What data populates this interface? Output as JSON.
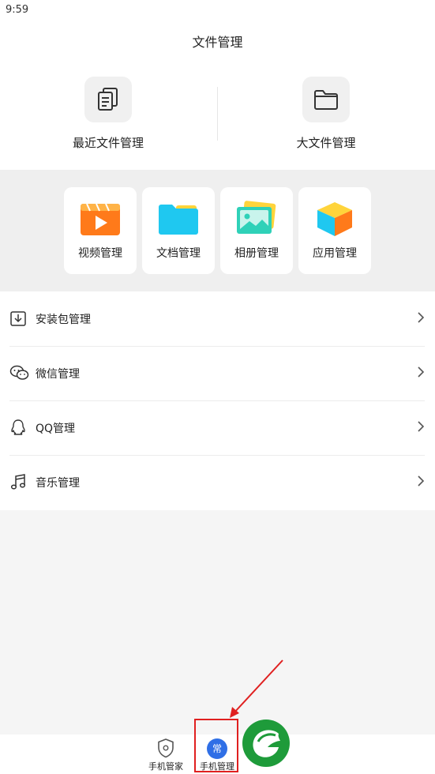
{
  "status_bar": {
    "time": "9:59"
  },
  "header": {
    "title": "文件管理"
  },
  "top_cards": [
    {
      "label": "最近文件管理",
      "icon": "recent-files-icon"
    },
    {
      "label": "大文件管理",
      "icon": "folder-icon"
    }
  ],
  "grid": [
    {
      "label": "视频管理",
      "icon": "video-icon"
    },
    {
      "label": "文档管理",
      "icon": "document-folder-icon"
    },
    {
      "label": "相册管理",
      "icon": "album-icon"
    },
    {
      "label": "应用管理",
      "icon": "app-cube-icon"
    }
  ],
  "list": [
    {
      "label": "安装包管理",
      "icon": "download-box-icon"
    },
    {
      "label": "微信管理",
      "icon": "wechat-icon"
    },
    {
      "label": "QQ管理",
      "icon": "qq-icon"
    },
    {
      "label": "音乐管理",
      "icon": "music-note-icon"
    }
  ],
  "bottom_nav": {
    "items": [
      {
        "label": "手机管家",
        "icon": "shield-icon"
      },
      {
        "label": "手机管理",
        "icon": "phone-manage-icon",
        "badge": "常"
      }
    ],
    "active_index": 1
  },
  "colors": {
    "accent_blue": "#2f6fe6",
    "highlight_red": "#e02020",
    "brand_green": "#1e9b3a"
  }
}
